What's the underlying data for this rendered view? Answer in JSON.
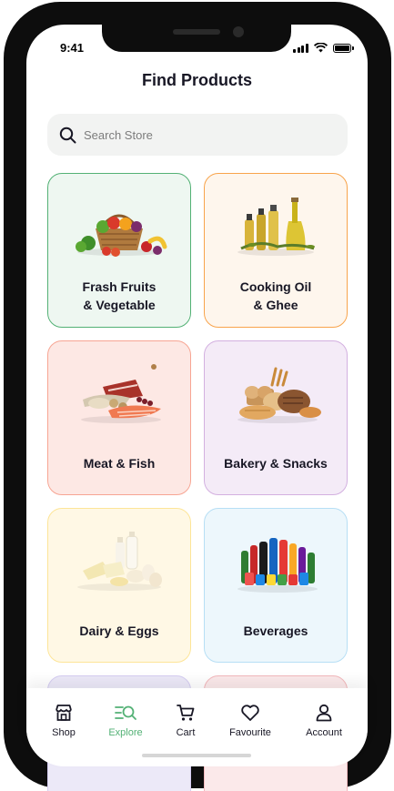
{
  "status_bar": {
    "time": "9:41"
  },
  "header": {
    "title": "Find Products"
  },
  "search": {
    "placeholder": "Search Store",
    "value": ""
  },
  "categories": [
    {
      "label": "Frash Fruits\n& Vegetable",
      "bg": "#eef7f1",
      "border": "#53b175"
    },
    {
      "label": "Cooking Oil\n& Ghee",
      "bg": "#fef6ed",
      "border": "#f8a44c"
    },
    {
      "label": "Meat & Fish",
      "bg": "#fde8e4",
      "border": "#f7a593"
    },
    {
      "label": "Bakery & Snacks",
      "bg": "#f4ebf7",
      "border": "#d3b0e0"
    },
    {
      "label": "Dairy & Eggs",
      "bg": "#fff8e5",
      "border": "#fde598"
    },
    {
      "label": "Beverages",
      "bg": "#edf7fc",
      "border": "#b7dff5"
    },
    {
      "bg": "#ece9f8",
      "border": "#d6cef2"
    },
    {
      "bg": "#fbe9ea",
      "border": "#f3b9bd"
    }
  ],
  "tabbar": {
    "items": [
      {
        "label": "Shop",
        "icon": "shop-icon",
        "active": false
      },
      {
        "label": "Explore",
        "icon": "explore-icon",
        "active": true
      },
      {
        "label": "Cart",
        "icon": "cart-icon",
        "active": false
      },
      {
        "label": "Favourite",
        "icon": "heart-icon",
        "active": false
      },
      {
        "label": "Account",
        "icon": "account-icon",
        "active": false
      }
    ]
  },
  "colors": {
    "accent": "#53b175",
    "text": "#181725",
    "muted": "#7c7c7c",
    "search_bg": "#f2f3f2"
  }
}
